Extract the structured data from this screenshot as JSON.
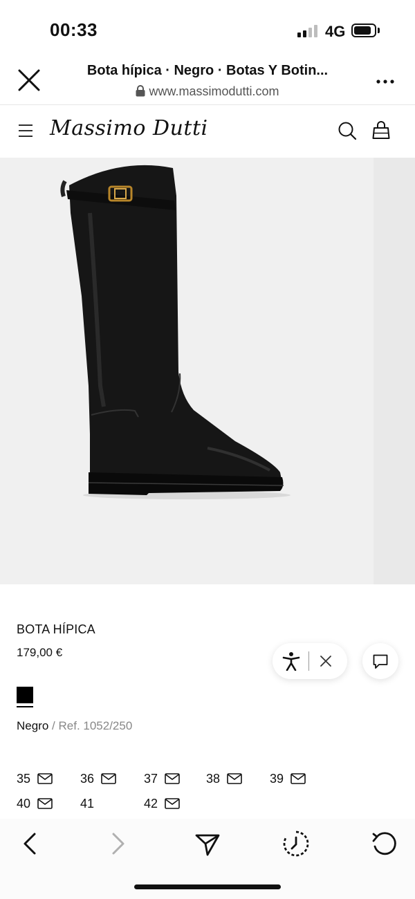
{
  "status_bar": {
    "time": "00:33",
    "network": "4G",
    "battery_level": 0.85
  },
  "browser": {
    "title": "Bota hípica · Negro · Botas Y Botin...",
    "url": "www.massimodutti.com",
    "icons": [
      "close-icon",
      "lock-icon",
      "more-icon"
    ]
  },
  "site_nav": {
    "logo": "Massimo Dutti",
    "icons": [
      "menu-icon",
      "search-icon",
      "bag-icon"
    ]
  },
  "product": {
    "name": "BOTA HÍPICA",
    "price": "179,00 €",
    "color_name": "Negro",
    "ref_separator": " / ",
    "ref": "Ref. 1052/250",
    "swatch_color": "#000000",
    "sizes": [
      {
        "label": "35",
        "notify": true
      },
      {
        "label": "36",
        "notify": true
      },
      {
        "label": "37",
        "notify": true
      },
      {
        "label": "38",
        "notify": true
      },
      {
        "label": "39",
        "notify": true
      },
      {
        "label": "40",
        "notify": true
      },
      {
        "label": "41",
        "notify": false
      },
      {
        "label": "42",
        "notify": true
      }
    ]
  },
  "floating": {
    "icons": [
      "accessibility-icon",
      "close-icon",
      "chat-icon"
    ]
  },
  "toolbar": {
    "icons": [
      "back-icon",
      "forward-icon",
      "share-icon",
      "history-icon",
      "reload-icon"
    ],
    "forward_enabled": false
  }
}
